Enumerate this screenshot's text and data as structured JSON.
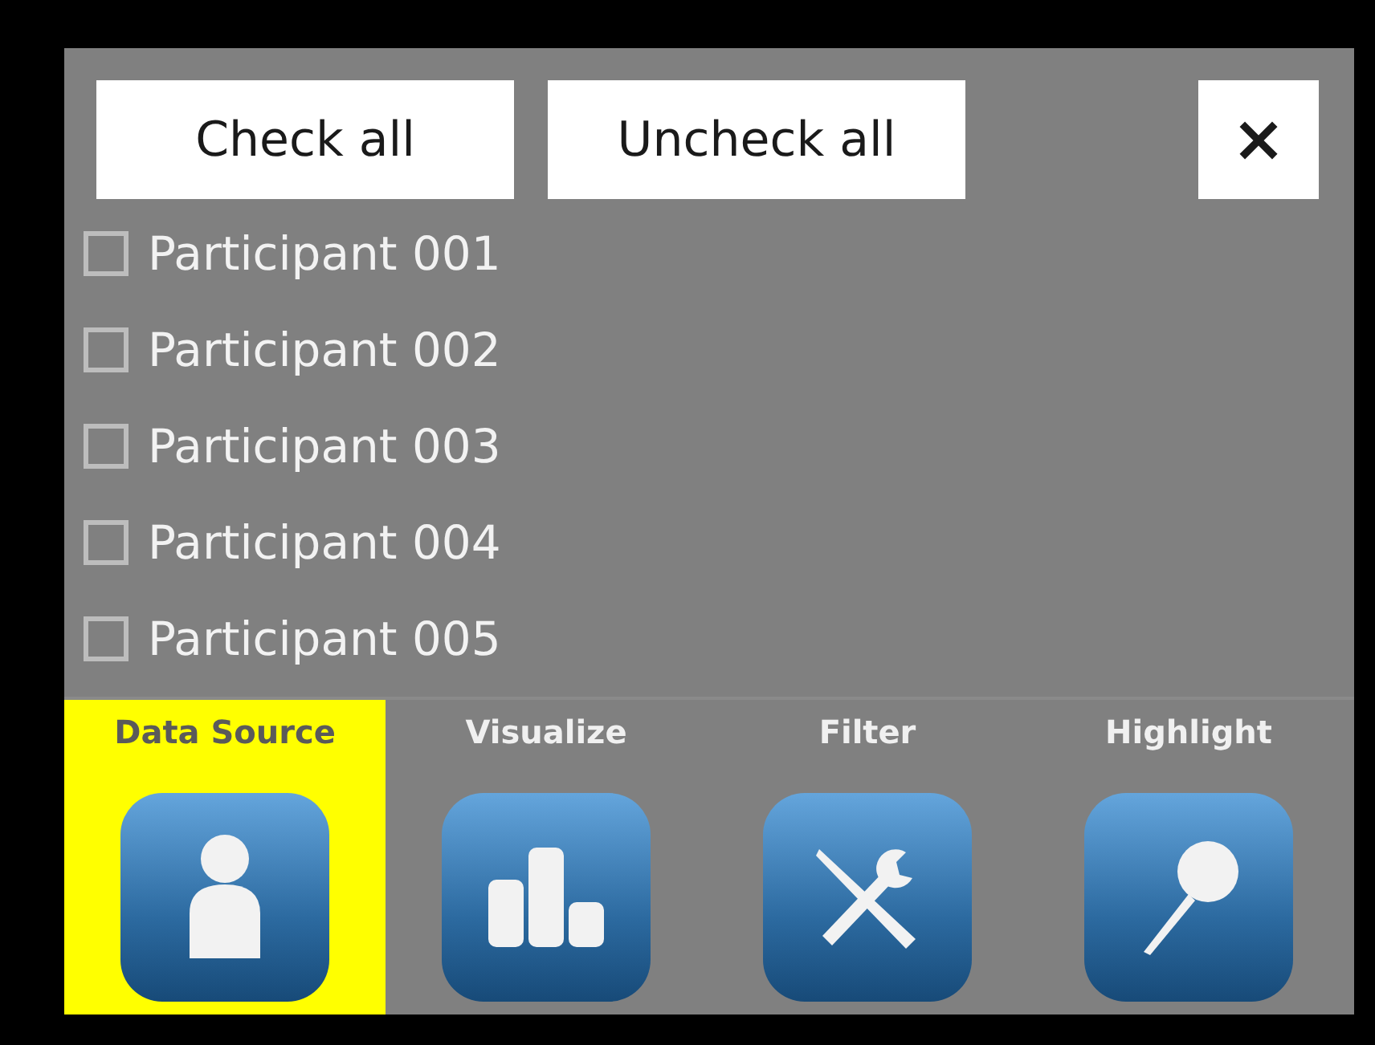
{
  "buttons": [
    {
      "label": "Check all"
    },
    {
      "label": "Uncheck all"
    }
  ],
  "close_button": {
    "label": "×"
  },
  "participants": [
    {
      "label": "Participant 001",
      "checked": false
    },
    {
      "label": "Participant 002",
      "checked": false
    },
    {
      "label": "Participant 003",
      "checked": false
    },
    {
      "label": "Participant 004",
      "checked": false
    },
    {
      "label": "Participant 005",
      "checked": false
    }
  ],
  "tabs": [
    {
      "label": "Data Source",
      "kind": "person",
      "selected": true
    },
    {
      "label": "Visualize",
      "kind": "bars",
      "selected": false
    },
    {
      "label": "Filter",
      "kind": "tools",
      "selected": false
    },
    {
      "label": "Highlight",
      "kind": "magnifier",
      "selected": false
    }
  ]
}
